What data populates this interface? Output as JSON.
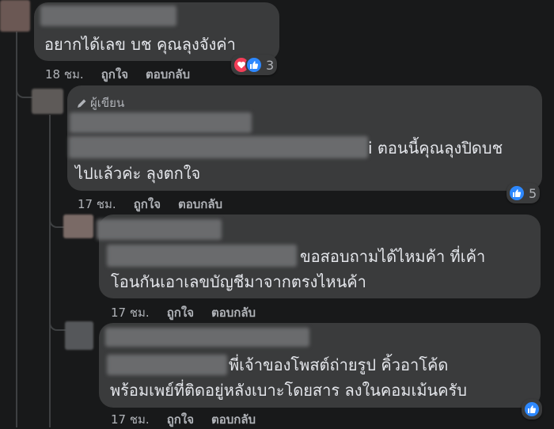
{
  "comments": [
    {
      "text_lines": [
        "อยากได้เลข บช คุณลุงจังค่า"
      ],
      "meta": {
        "time": "18 ชม.",
        "like": "ถูกใจ",
        "reply": "ตอบกลับ"
      },
      "reaction_count": "3",
      "reaction_icons": [
        "love-icon",
        "like-icon"
      ]
    },
    {
      "author_badge": "ผู้เขียน",
      "text_lines": [
        "i ตอนนี้คุณลุงปิดบช",
        "ไปแล้วค่ะ ลุงตกใจ"
      ],
      "meta": {
        "time": "17 ชม.",
        "like": "ถูกใจ",
        "reply": "ตอบกลับ"
      },
      "reaction_count": "5",
      "reaction_icons": [
        "like-icon"
      ]
    },
    {
      "text_lines": [
        "ขอสอบถามได้ไหมค้า ที่เค้า",
        "โอนกันเอาเลขบัญชีมาจากตรงไหนค้า"
      ],
      "meta": {
        "time": "17 ชม.",
        "like": "ถูกใจ",
        "reply": "ตอบกลับ"
      }
    },
    {
      "text_lines": [
        "พี่เจ้าของโพสต์ถ่ายรูป คิ้วอาโค้ด",
        "พร้อมเพย์ที่ติดอยู่หลังเบาะโดยสาร ลงในคอมเม้นครับ"
      ],
      "meta": {
        "time": "17 ชม.",
        "like": "ถูกใจ",
        "reply": "ตอบกลับ"
      },
      "reaction_icons": [
        "like-icon"
      ]
    }
  ],
  "colors": {
    "background": "#18191a",
    "bubble": "#3a3b3c",
    "text": "#e4e6eb",
    "meta": "#b0b3b8",
    "like": "#2d88ff",
    "love": "#f33e58"
  }
}
